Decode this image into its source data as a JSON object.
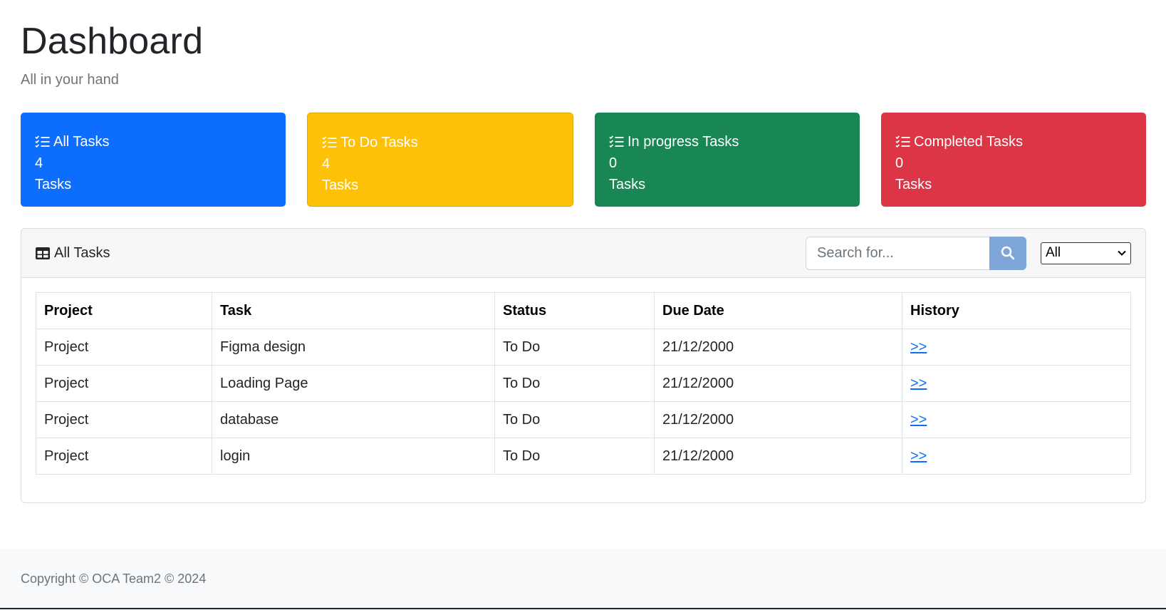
{
  "header": {
    "title": "Dashboard",
    "subtitle": "All in your hand"
  },
  "stats": [
    {
      "label": "All Tasks",
      "count": "4",
      "unit": "Tasks",
      "color": "#0d6efd",
      "icon": "list-check-icon"
    },
    {
      "label": "To Do Tasks",
      "count": "4",
      "unit": "Tasks",
      "color": "#ffc107",
      "icon": "list-check-icon"
    },
    {
      "label": "In progress Tasks",
      "count": "0",
      "unit": "Tasks",
      "color": "#198754",
      "icon": "list-check-icon"
    },
    {
      "label": "Completed Tasks",
      "count": "0",
      "unit": "Tasks",
      "color": "#dc3545",
      "icon": "list-check-icon"
    }
  ],
  "tasks_panel": {
    "title": "All Tasks",
    "icon": "table-icon",
    "search_placeholder": "Search for...",
    "search_icon": "search-icon",
    "filter_selected": "All",
    "columns": [
      "Project",
      "Task",
      "Status",
      "Due Date",
      "History"
    ],
    "rows": [
      {
        "project": "Project",
        "task": "Figma design",
        "status": "To Do",
        "due": "21/12/2000",
        "history": ">>"
      },
      {
        "project": "Project",
        "task": "Loading Page",
        "status": "To Do",
        "due": "21/12/2000",
        "history": ">>"
      },
      {
        "project": "Project",
        "task": "database",
        "status": "To Do",
        "due": "21/12/2000",
        "history": ">>"
      },
      {
        "project": "Project",
        "task": "login",
        "status": "To Do",
        "due": "21/12/2000",
        "history": ">>"
      }
    ]
  },
  "footer": {
    "copyright": "Copyright © OCA Team2 © 2024"
  }
}
